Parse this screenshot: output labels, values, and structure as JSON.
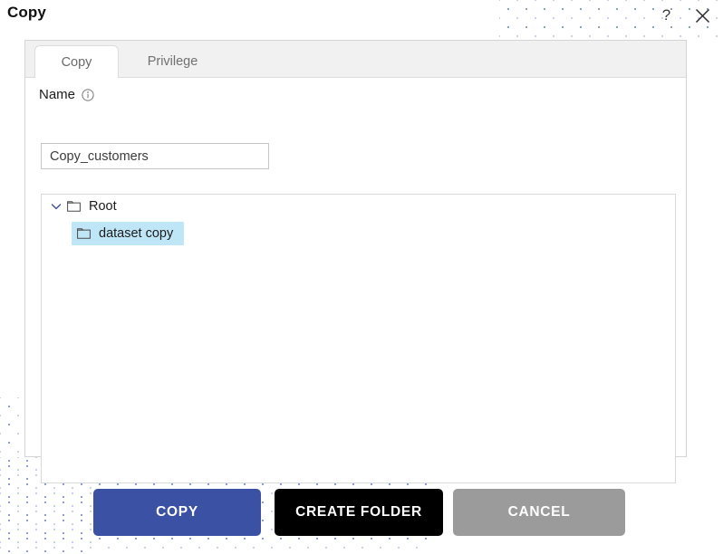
{
  "window": {
    "title": "Copy",
    "help_icon": "question-mark-icon",
    "close_icon": "close-x-icon"
  },
  "tabs": [
    {
      "label": "Copy",
      "active": true
    },
    {
      "label": "Privilege",
      "active": false
    }
  ],
  "form": {
    "name_label": "Name",
    "name_info_icon": "info-circle-icon",
    "name_value": "Copy_customers",
    "name_placeholder": "Copy_customers"
  },
  "tree": {
    "nodes": [
      {
        "label": "Root",
        "expanded": true,
        "chevron_icon": "chevron-down-icon",
        "folder_icon": "folder-icon",
        "selected": false
      },
      {
        "label": "dataset copy",
        "expanded": false,
        "folder_icon": "folder-icon",
        "selected": true
      }
    ]
  },
  "buttons": {
    "copy": "COPY",
    "create_folder": "CREATE FOLDER",
    "cancel": "CANCEL"
  },
  "colors": {
    "primary": "#3b51a3",
    "secondary": "#000000",
    "disabled": "#9b9b9b",
    "selection": "#bfe6f7",
    "dots": "#8e9ddb"
  }
}
